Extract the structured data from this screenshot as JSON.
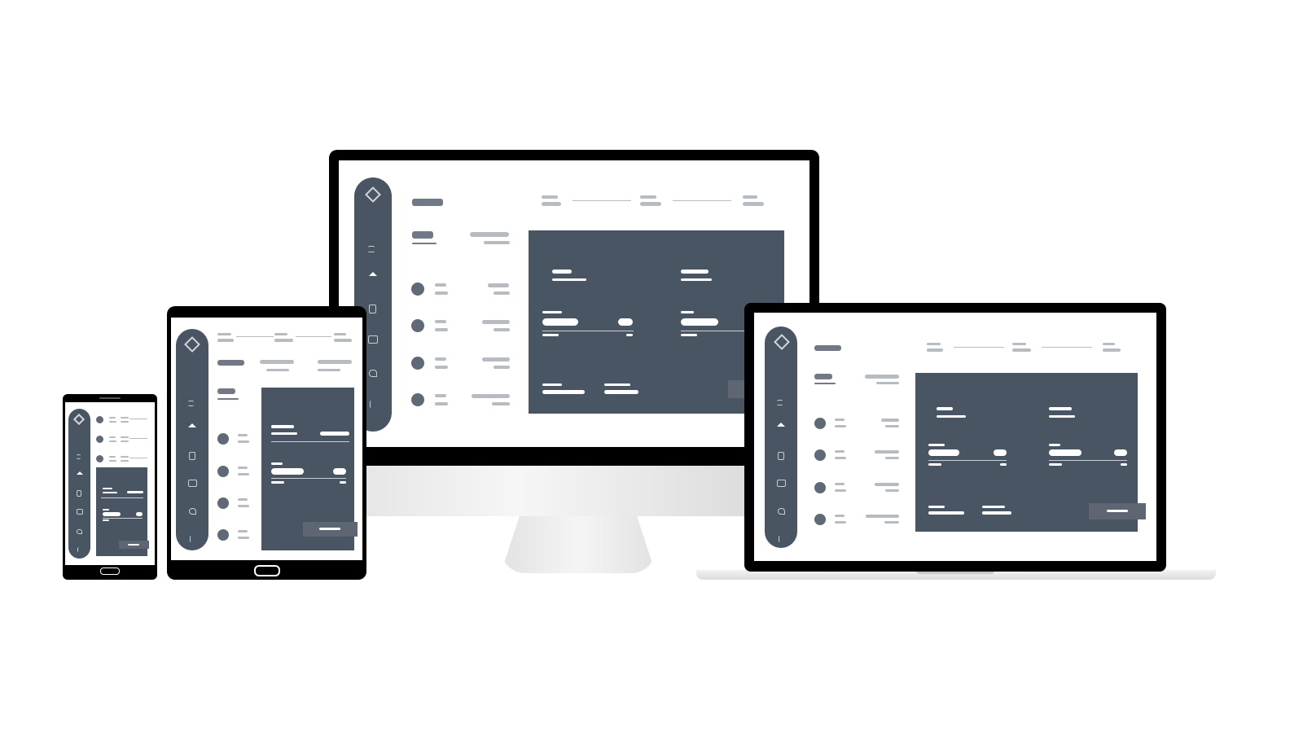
{
  "scene": {
    "description_text": "",
    "devices": [
      "desktop-monitor",
      "laptop",
      "tablet",
      "phone"
    ]
  },
  "colors": {
    "sidebar": "#4a5563",
    "panel": "#4a5563",
    "placeholder_light": "#b7bcc3",
    "placeholder_dark": "#707985",
    "bezel": "#000000",
    "stand": "#e4e4e4"
  },
  "icons": [
    "logo-icon",
    "menu-icon",
    "home-icon",
    "document-icon",
    "building-icon",
    "heart-icon",
    "hand-icon"
  ]
}
